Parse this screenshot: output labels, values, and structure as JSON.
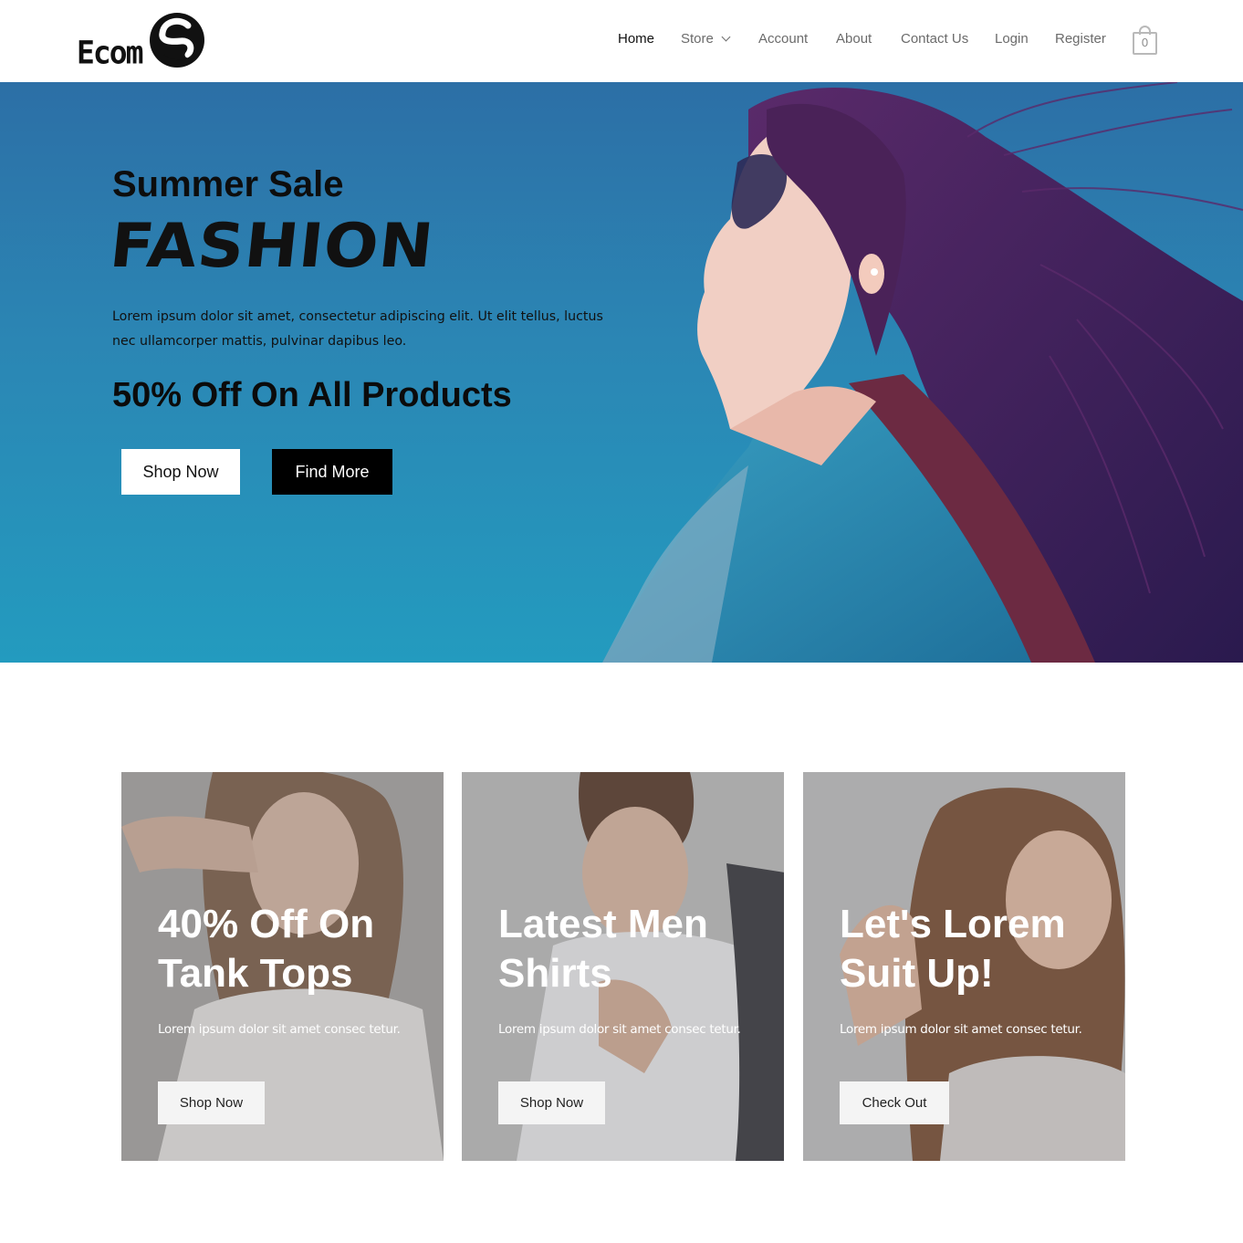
{
  "header": {
    "logo_text": "Ecom",
    "nav": [
      {
        "label": "Home",
        "active": true
      },
      {
        "label": "Store",
        "has_dropdown": true
      },
      {
        "label": "Account"
      },
      {
        "label": "About"
      },
      {
        "label": "Contact Us"
      },
      {
        "label": "Login"
      },
      {
        "label": "Register"
      }
    ],
    "cart_count": "0"
  },
  "hero": {
    "title": "Summer Sale",
    "headline": "FASHION",
    "description": "Lorem ipsum dolor sit amet, consectetur adipiscing elit. Ut elit tellus, luctus nec ullamcorper mattis, pulvinar dapibus leo.",
    "offer": "50% Off On All Products",
    "primary_button": "Shop Now",
    "secondary_button": "Find More"
  },
  "cards": [
    {
      "title_line1": "40% Off On",
      "title_line2": "Tank Tops",
      "description": "Lorem ipsum dolor sit amet consec tetur.",
      "button": "Shop Now"
    },
    {
      "title_line1": "Latest Men",
      "title_line2": "Shirts",
      "description": "Lorem ipsum dolor sit amet consec tetur.",
      "button": "Shop Now"
    },
    {
      "title_line1": "Let's Lorem",
      "title_line2": "Suit Up!",
      "description": "Lorem ipsum dolor sit amet consec tetur.",
      "button": "Check Out"
    }
  ],
  "colors": {
    "hero_sky": "#2886b5",
    "button_dark": "#000000",
    "nav_text": "#6b6b6b"
  }
}
